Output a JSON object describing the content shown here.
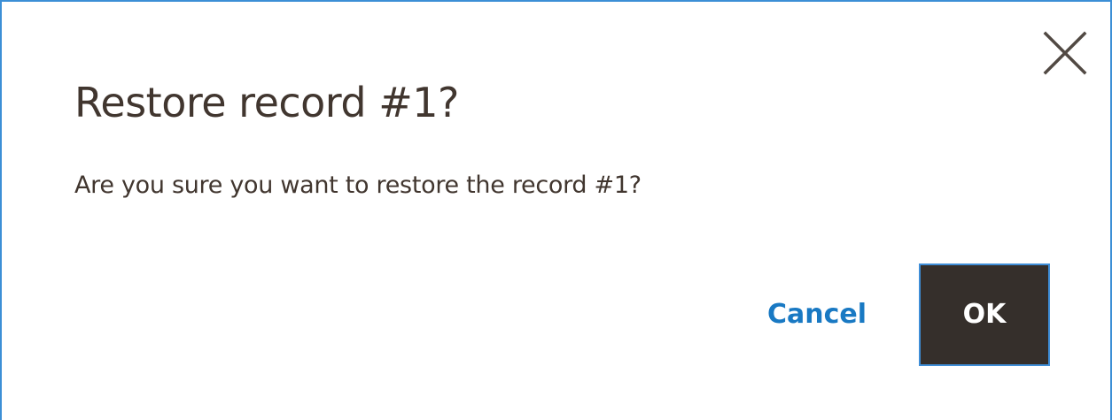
{
  "dialog": {
    "title": "Restore record #1?",
    "message": "Are you sure you want to restore the record #1?",
    "close_icon": "close-icon",
    "buttons": {
      "cancel_label": "Cancel",
      "ok_label": "OK"
    },
    "colors": {
      "border": "#3c8fd6",
      "text": "#41362f",
      "cancel_link": "#1979c3",
      "ok_background": "#352f2b",
      "ok_border": "#3f8ed8",
      "ok_text": "#ffffff"
    }
  }
}
